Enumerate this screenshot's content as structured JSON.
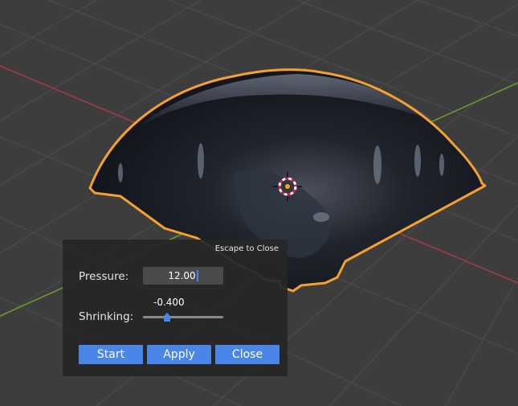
{
  "viewport": {
    "background": "#3d3d3d",
    "axis_x_color": "#a03a48",
    "axis_y_color": "#6a9a2a",
    "selection_outline_color": "#f5a030",
    "icons": [
      "3d-cursor-icon",
      "origin-dot-icon"
    ]
  },
  "panel": {
    "escape_hint": "Escape to Close",
    "pressure": {
      "label": "Pressure:",
      "value": "12.00"
    },
    "shrinking": {
      "label": "Shrinking:",
      "value": "-0.400",
      "slider_fraction": 0.3
    },
    "buttons": {
      "start": "Start",
      "apply": "Apply",
      "close": "Close"
    },
    "button_color": "#4a86e8"
  }
}
